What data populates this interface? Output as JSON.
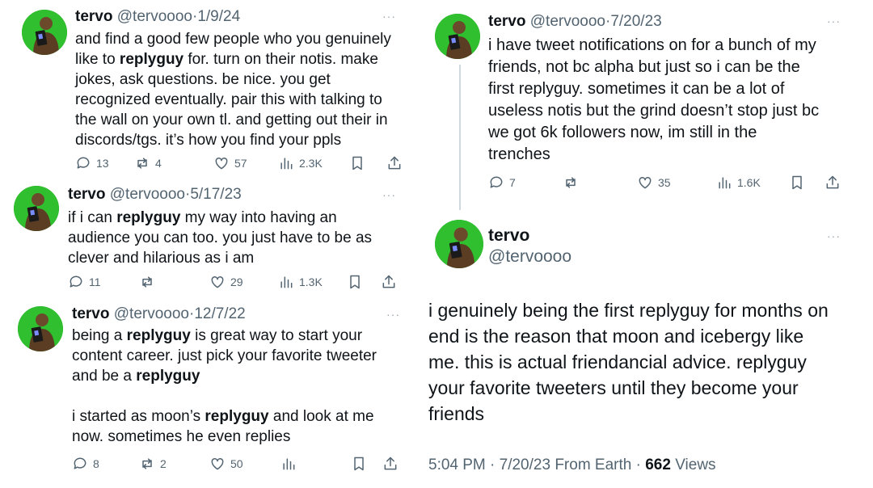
{
  "tweets": [
    {
      "name": "tervo",
      "handle": "@tervoooo",
      "sep": "·",
      "date": "1/9/24",
      "more": "···",
      "lines": [
        "and find a good few people who you genuinely",
        "like to |replyguy| for. turn on their notis. make",
        "jokes, ask questions. be nice. you get",
        "recognized eventually. pair this with talking to",
        "the wall on your own tl. and getting out their in",
        "discords/tgs. it’s how you find your ppls"
      ],
      "replies": "13",
      "reposts": "4",
      "likes": "57",
      "views": "2.3K"
    },
    {
      "name": "tervo",
      "handle": "@tervoooo",
      "sep": "·",
      "date": "5/17/23",
      "more": "···",
      "lines": [
        "if i can |replyguy| my way into having an",
        "audience you can too. you just have to be as",
        "clever and hilarious as i am"
      ],
      "replies": "11",
      "reposts": "",
      "likes": "29",
      "views": "1.3K"
    },
    {
      "name": "tervo",
      "handle": "@tervoooo",
      "sep": "·",
      "date": "12/7/22",
      "more": "···",
      "lines": [
        "being a |replyguy| is great way to start your",
        "content career. just pick your favorite tweeter",
        "and be a |replyguy|",
        "",
        "i started as moon’s |replyguy| and look at me",
        "now. sometimes he even replies"
      ],
      "replies": "8",
      "reposts": "2",
      "likes": "50",
      "views": ""
    },
    {
      "name": "tervo",
      "handle": "@tervoooo",
      "sep": "·",
      "date": "7/20/23",
      "more": "···",
      "lines": [
        "i have tweet notifications on for a bunch of my",
        "friends, not bc alpha but just so i can be the",
        "first replyguy. sometimes it can be a lot of",
        "useless notis but the grind doesn’t stop just bc",
        "we got 6k followers now, im still in the",
        "trenches"
      ],
      "replies": "7",
      "reposts": "",
      "likes": "35",
      "views": "1.6K"
    }
  ],
  "main_tweet": {
    "name": "tervo",
    "handle": "@tervoooo",
    "more": "···",
    "lines": [
      "i genuinely being the first replyguy for months on",
      "end is the reason that moon and icebergy like",
      "me. this is actual friendancial advice. replyguy",
      "your favorite tweeters until they become your",
      "friends"
    ],
    "time": "5:04 PM · 7/20/23 From Earth ·",
    "views_count": "662",
    "views_label": "Views"
  },
  "icons": [
    "reply-icon",
    "repost-icon",
    "like-icon",
    "views-icon",
    "bookmark-icon",
    "share-icon"
  ],
  "colors": {
    "text": "#0f1419",
    "muted": "#536471",
    "thread_line": "#cfd9de",
    "avatar_bg": "#2fbf2f"
  }
}
